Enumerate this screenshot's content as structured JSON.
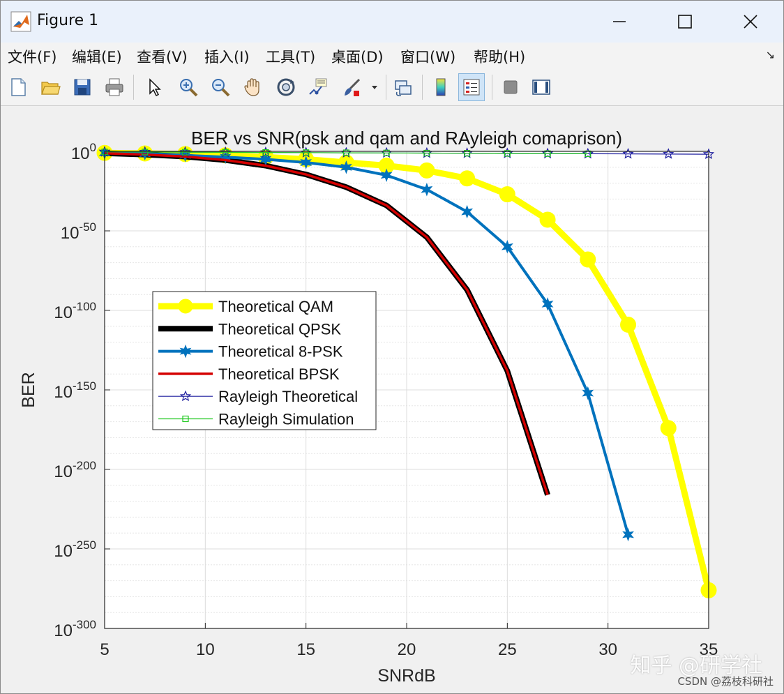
{
  "window": {
    "title": "Figure 1"
  },
  "menu": [
    "文件(F)",
    "编辑(E)",
    "查看(V)",
    "插入(I)",
    "工具(T)",
    "桌面(D)",
    "窗口(W)",
    "帮助(H)"
  ],
  "toolbar": {
    "buttons": [
      "new-figure-icon",
      "open-icon",
      "save-icon",
      "print-icon",
      "edit-plot-icon",
      "zoom-in-icon",
      "zoom-out-icon",
      "pan-icon",
      "rotate-3d-icon",
      "data-cursor-icon",
      "brush-icon",
      "link-plot-icon",
      "colorbar-icon",
      "legend-icon",
      "hide-plot-tools-icon",
      "show-plot-tools-icon"
    ],
    "active": "legend-icon"
  },
  "watermark": {
    "main": "知乎 @研学社",
    "sub": "CSDN @荔枝科研社"
  },
  "chart_data": {
    "type": "line",
    "title": "BER vs SNR(psk and qam and RAyleigh comaprison)",
    "xlabel": "SNRdB",
    "ylabel": "BER",
    "xlim": [
      5,
      35
    ],
    "ylim_exponent": [
      -300,
      0
    ],
    "yscale": "log",
    "xticks": [
      5,
      10,
      15,
      20,
      25,
      30,
      35
    ],
    "yticks": [
      {
        "base": "10",
        "exp": "0",
        "value": 0
      },
      {
        "base": "10",
        "exp": "-50",
        "value": -50
      },
      {
        "base": "10",
        "exp": "-100",
        "value": -100
      },
      {
        "base": "10",
        "exp": "-150",
        "value": -150
      },
      {
        "base": "10",
        "exp": "-200",
        "value": -200
      },
      {
        "base": "10",
        "exp": "-250",
        "value": -250
      },
      {
        "base": "10",
        "exp": "-300",
        "value": -300
      }
    ],
    "grid": true,
    "legend_position": "center-left",
    "y_values_are_log10": true,
    "series": [
      {
        "name": "Theoretical QAM",
        "color": "#ffff00",
        "marker": "circle",
        "x": [
          5,
          7,
          9,
          11,
          13,
          15,
          17,
          19,
          21,
          23,
          25,
          27,
          29,
          31,
          33,
          35
        ],
        "y": [
          -1,
          -1.3,
          -1.7,
          -2.5,
          -3.6,
          -5,
          -7,
          -9,
          -12,
          -17,
          -27,
          -43,
          -68,
          -109,
          -174,
          -276
        ]
      },
      {
        "name": "Theoretical QPSK",
        "color": "#000000",
        "marker": "none",
        "x": [
          5,
          7,
          9,
          11,
          13,
          15,
          17,
          19,
          21,
          23,
          25,
          27
        ],
        "y": [
          -1.2,
          -2,
          -3.3,
          -5.5,
          -9,
          -14.5,
          -22.5,
          -34,
          -54,
          -87,
          -138,
          -216
        ]
      },
      {
        "name": "Theoretical 8-PSK",
        "color": "#0072bd",
        "marker": "star",
        "x": [
          5,
          7,
          9,
          11,
          13,
          15,
          17,
          19,
          21,
          23,
          25,
          27,
          29,
          31
        ],
        "y": [
          -1,
          -1.5,
          -2.5,
          -3.6,
          -5,
          -7,
          -10,
          -15,
          -24,
          -38,
          -60,
          -96,
          -152,
          -241
        ]
      },
      {
        "name": "Theoretical BPSK",
        "color": "#d40000",
        "marker": "none",
        "x": [
          5,
          7,
          9,
          11,
          13,
          15,
          17,
          19,
          21,
          23,
          25,
          27
        ],
        "y": [
          -1.2,
          -2,
          -3.3,
          -5.5,
          -9,
          -14.5,
          -22.5,
          -34,
          -54,
          -87,
          -138,
          -216
        ]
      },
      {
        "name": "Rayleigh Theoretical",
        "color": "#1d1d9e",
        "marker": "pentagram",
        "x": [
          5,
          7,
          9,
          11,
          13,
          15,
          17,
          19,
          21,
          23,
          25,
          27,
          29,
          31,
          33,
          35
        ],
        "y": [
          -0.3,
          -0.4,
          -0.5,
          -0.6,
          -0.7,
          -0.8,
          -0.9,
          -1,
          -1.1,
          -1.2,
          -1.3,
          -1.4,
          -1.5,
          -1.6,
          -1.7,
          -1.8
        ]
      },
      {
        "name": "Rayleigh Simulation",
        "color": "#22c922",
        "marker": "square",
        "x": [
          5,
          7,
          9,
          11,
          13,
          15,
          17,
          19,
          21,
          23,
          25,
          27,
          29
        ],
        "y": [
          -0.3,
          -0.4,
          -0.5,
          -0.6,
          -0.7,
          -0.8,
          -0.9,
          -1,
          -1.1,
          -1.2,
          -1.3,
          -1.4,
          -1.5
        ]
      }
    ]
  }
}
